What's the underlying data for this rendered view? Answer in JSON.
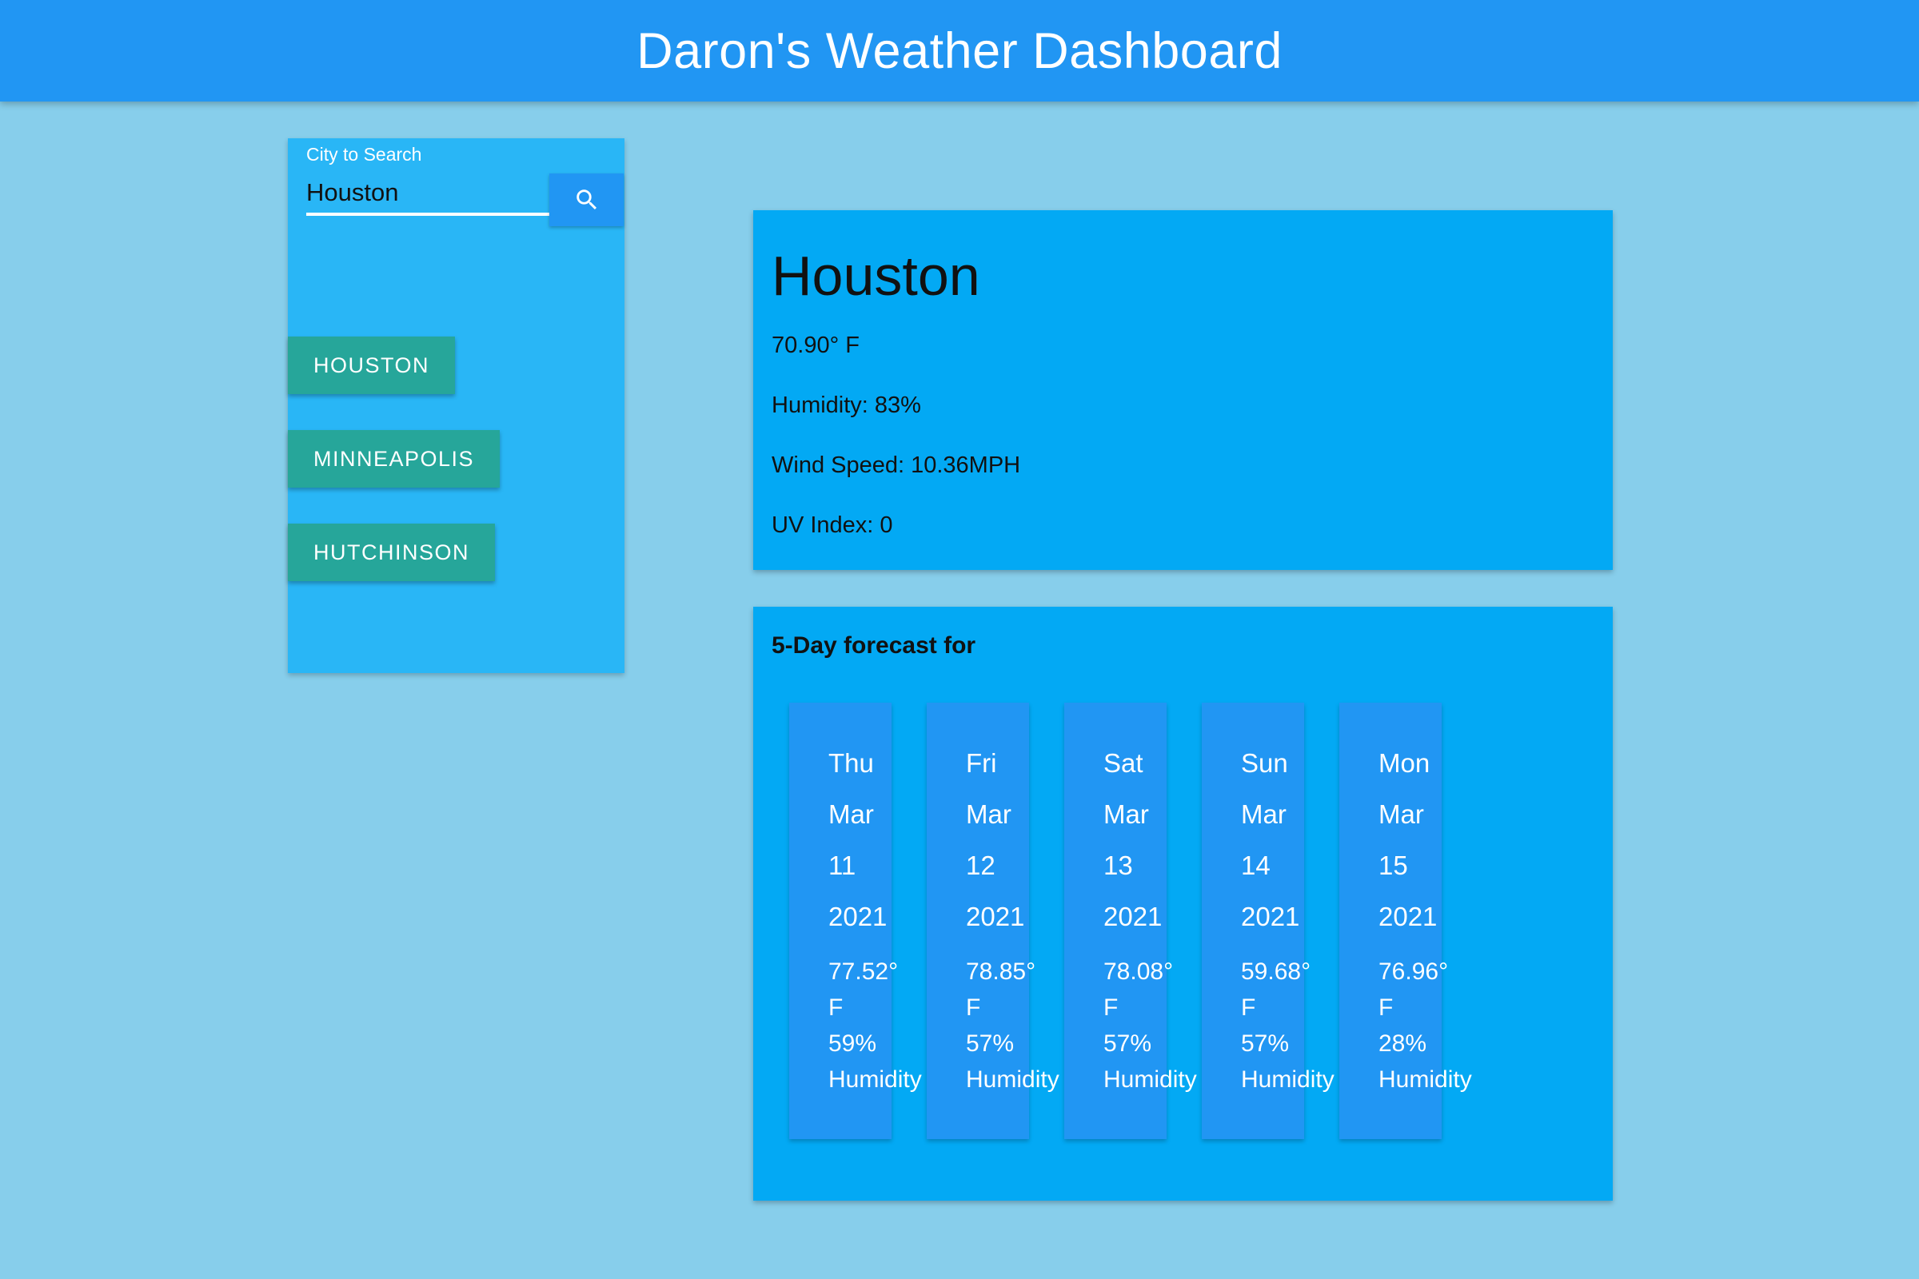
{
  "header": {
    "title": "Daron's Weather Dashboard"
  },
  "search": {
    "label": "City to Search",
    "value": "Houston",
    "button_icon": "search-icon"
  },
  "history": [
    {
      "label": "HOUSTON"
    },
    {
      "label": "MINNEAPOLIS"
    },
    {
      "label": "HUTCHINSON"
    }
  ],
  "current": {
    "city": "Houston",
    "temperature": "70.90° F",
    "humidity": "Humidity: 83%",
    "wind": "Wind Speed: 10.36MPH",
    "uv": "UV Index: 0"
  },
  "forecast": {
    "title": "5-Day forecast for",
    "days": [
      {
        "weekday": "Thu",
        "month": "Mar",
        "day": "11",
        "year": "2021",
        "temp": "77.52°",
        "temp_unit": "F",
        "humidity": "59%",
        "humidity_label": "Humidity"
      },
      {
        "weekday": "Fri",
        "month": "Mar",
        "day": "12",
        "year": "2021",
        "temp": "78.85°",
        "temp_unit": "F",
        "humidity": "57%",
        "humidity_label": "Humidity"
      },
      {
        "weekday": "Sat",
        "month": "Mar",
        "day": "13",
        "year": "2021",
        "temp": "78.08°",
        "temp_unit": "F",
        "humidity": "57%",
        "humidity_label": "Humidity"
      },
      {
        "weekday": "Sun",
        "month": "Mar",
        "day": "14",
        "year": "2021",
        "temp": "59.68°",
        "temp_unit": "F",
        "humidity": "57%",
        "humidity_label": "Humidity"
      },
      {
        "weekday": "Mon",
        "month": "Mar",
        "day": "15",
        "year": "2021",
        "temp": "76.96°",
        "temp_unit": "F",
        "humidity": "28%",
        "humidity_label": "Humidity"
      }
    ]
  },
  "colors": {
    "page_background": "#87ceeb",
    "header": "#2196f3",
    "card": "#03a9f4",
    "sidebar": "#29b6f6",
    "history_button": "#26a69a",
    "forecast_day": "#2196f3"
  }
}
